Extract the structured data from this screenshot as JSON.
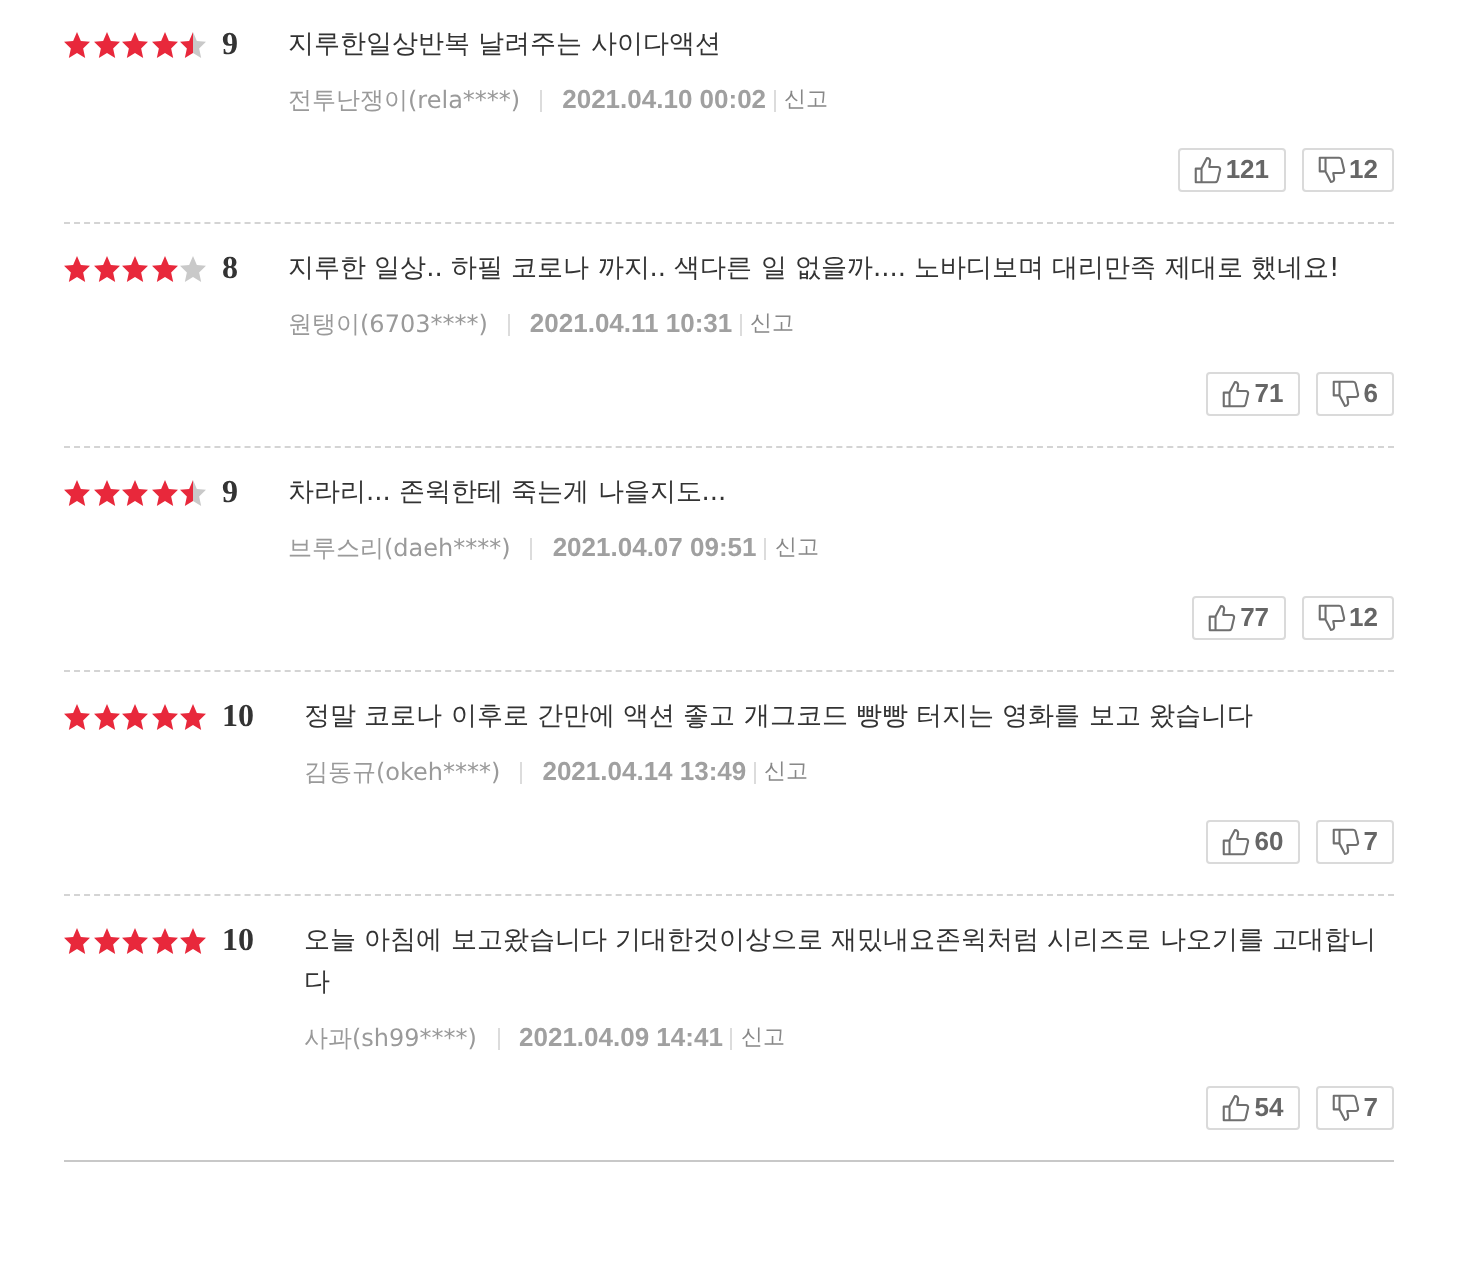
{
  "reviews": [
    {
      "stars": 4.5,
      "score": "9",
      "text": "지루한일상반복 날려주는 사이다액션",
      "author": "전투난쟁이(rela****)",
      "date": "2021.04.10 00:02",
      "report": "신고",
      "likes": "121",
      "dislikes": "12"
    },
    {
      "stars": 4,
      "score": "8",
      "text": "지루한 일상.. 하필 코로나 까지.. 색다른 일 없을까.... 노바디보며 대리만족 제대로 했네요!",
      "author": "원탱이(6703****)",
      "date": "2021.04.11 10:31",
      "report": "신고",
      "likes": "71",
      "dislikes": "6"
    },
    {
      "stars": 4.5,
      "score": "9",
      "text": "차라리... 존윅한테 죽는게 나을지도...",
      "author": "브루스리(daeh****)",
      "date": "2021.04.07 09:51",
      "report": "신고",
      "likes": "77",
      "dislikes": "12"
    },
    {
      "stars": 5,
      "score": "10",
      "text": "정말 코로나 이후로 간만에 액션 좋고 개그코드 빵빵 터지는 영화를 보고 왔습니다",
      "author": "김동규(okeh****)",
      "date": "2021.04.14 13:49",
      "report": "신고",
      "likes": "60",
      "dislikes": "7"
    },
    {
      "stars": 5,
      "score": "10",
      "text": "오늘 아침에 보고왔습니다 기대한것이상으로 재밌내요존윅처럼 시리즈로 나오기를 고대합니다",
      "author": "사과(sh99****)",
      "date": "2021.04.09 14:41",
      "report": "신고",
      "likes": "54",
      "dislikes": "7"
    }
  ]
}
